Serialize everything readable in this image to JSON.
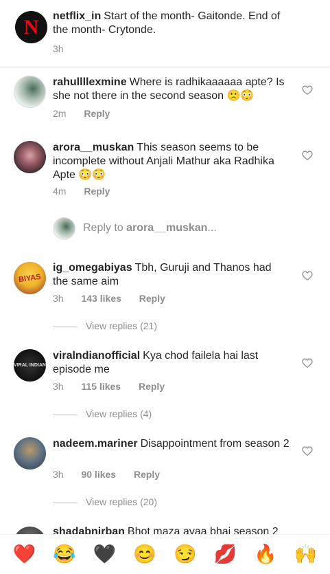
{
  "caption": {
    "username": "netflix_in",
    "text": "Start of the month- Gaitonde. End of the month- Crytonde.",
    "time": "3h",
    "avatar_letter": "N"
  },
  "comments": [
    {
      "username": "rahullllexmine",
      "text": "Where is radhikaaaaaa apte? Is she not there in the second season 🙁😳",
      "time": "2m",
      "reply": "Reply"
    },
    {
      "username": "arora__muskan",
      "text": "This season seems to be incomplete without Anjali Mathur aka Radhika Apte 😳😳",
      "time": "4m",
      "reply": "Reply",
      "reply_to_prefix": "Reply to ",
      "reply_to_user": "arora__muskan",
      "reply_to_suffix": "..."
    },
    {
      "username": "ig_omegabiyas",
      "text": "Tbh, Guruji and Thanos had the same aim",
      "time": "3h",
      "likes": "143 likes",
      "reply": "Reply",
      "view_replies": "View replies (21)",
      "avatar_text": "BIYAS"
    },
    {
      "username": "viralndianofficial",
      "text": "Kya chod failela hai last episode me",
      "time": "3h",
      "likes": "115 likes",
      "reply": "Reply",
      "view_replies": "View replies (4)",
      "avatar_text": "VIRAL INDIAN"
    },
    {
      "username": "nadeem.mariner",
      "text": "Disappointment from season 2",
      "time": "3h",
      "likes": "90 likes",
      "reply": "Reply",
      "view_replies": "View replies (20)"
    },
    {
      "username": "shadabnirban",
      "text": "Bhot maza ayaa bhai season 2"
    }
  ],
  "emoji_bar": [
    "❤️",
    "😂",
    "🖤",
    "😊",
    "😏",
    "💋",
    "🔥",
    "🙌"
  ],
  "colors": {
    "text": "#262626",
    "meta": "#8e8e8e",
    "divider": "#dbdbdb"
  }
}
